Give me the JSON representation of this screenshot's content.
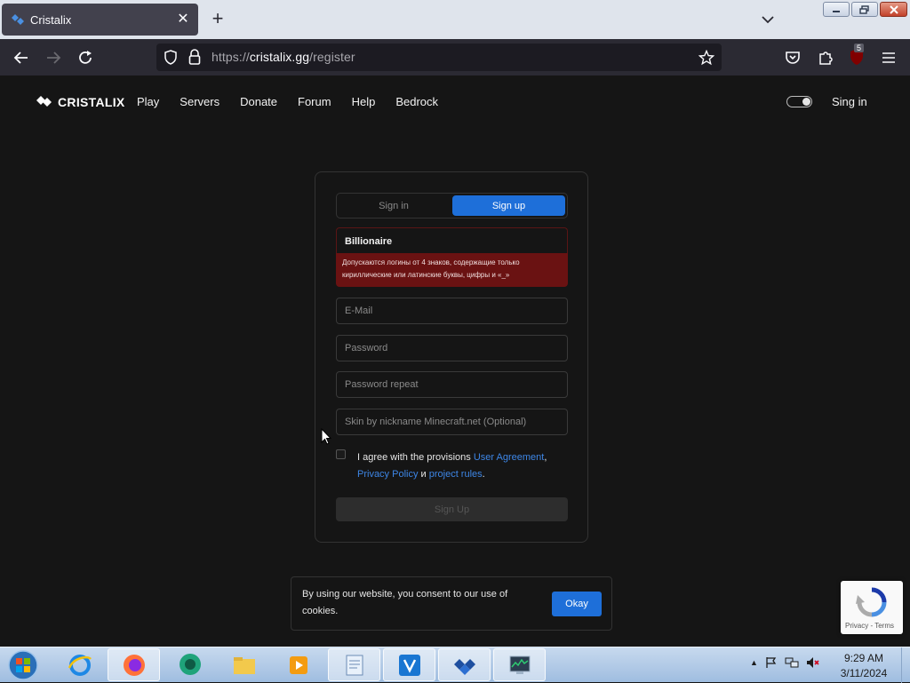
{
  "browser": {
    "tab_title": "Cristalix",
    "url_protocol": "https://",
    "url_host": "cristalix.gg",
    "url_path": "/register",
    "extension_badge": "5"
  },
  "site": {
    "logo_text": "CRISTALIX",
    "nav": [
      "Play",
      "Servers",
      "Donate",
      "Forum",
      "Help",
      "Bedrock"
    ],
    "signin_link": "Sing in"
  },
  "form": {
    "tab_signin": "Sign in",
    "tab_signup": "Sign up",
    "login_value": "Billionaire",
    "login_error": "Допускаются логины от 4 знаков, содержащие только кириллические или латинские буквы, цифры и «_»",
    "email_placeholder": "E-Mail",
    "password_placeholder": "Password",
    "password_repeat_placeholder": "Password repeat",
    "skin_placeholder": "Skin by nickname Minecraft.net (Optional)",
    "agree_prefix": "I agree with the provisions ",
    "user_agreement": "User Agreement",
    "comma": ",",
    "privacy_policy": "Privacy Policy",
    "and": " и ",
    "project_rules": "project rules",
    "period": ".",
    "submit_label": "Sign Up"
  },
  "cookie": {
    "text": "By using our website, you consent to our use of cookies.",
    "button": "Okay"
  },
  "recaptcha": {
    "privacy": "Privacy",
    "separator": " - ",
    "terms": "Terms"
  },
  "taskbar": {
    "time": "9:29 AM",
    "date": "3/11/2024"
  },
  "colors": {
    "accent": "#1e6fd9",
    "error_bg": "#6a1212",
    "page_bg": "#151515"
  }
}
